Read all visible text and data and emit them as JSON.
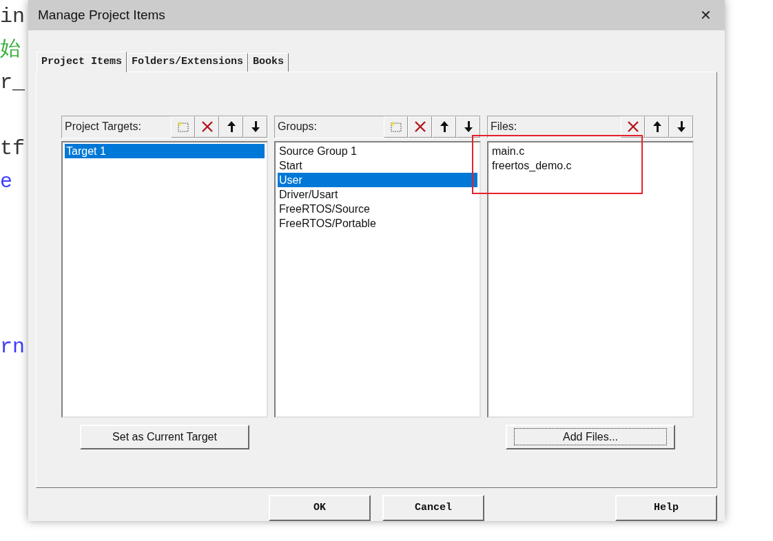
{
  "editor": {
    "lines": [
      {
        "kind": "code",
        "text": "in",
        "color": "#333333"
      },
      {
        "kind": "code",
        "text": "始",
        "color": "#3cb043"
      },
      {
        "kind": "code",
        "text": "r_",
        "color": "#333333"
      },
      {
        "kind": "blank"
      },
      {
        "kind": "code",
        "text": "tf",
        "color": "#333333"
      },
      {
        "kind": "code",
        "text": "e",
        "color": "#3b3bff"
      },
      {
        "kind": "blank"
      },
      {
        "kind": "blank"
      },
      {
        "kind": "blank"
      },
      {
        "kind": "blank"
      },
      {
        "kind": "code",
        "text": "rn",
        "color": "#3b3bff"
      }
    ]
  },
  "window": {
    "title": "Manage Project Items",
    "close": "✕"
  },
  "tabs": [
    {
      "label": "Project Items",
      "selected": true
    },
    {
      "label": "Folders/Extensions",
      "selected": false
    },
    {
      "label": "Books",
      "selected": false
    }
  ],
  "panels": [
    {
      "label": "Project Targets:",
      "tools": [
        {
          "kind": "new"
        },
        {
          "kind": "delete"
        },
        {
          "kind": "up"
        },
        {
          "kind": "down"
        }
      ],
      "items": [
        {
          "label": "Target 1",
          "selected": true
        }
      ],
      "button": {
        "label": "Set as Current Target",
        "focused": false
      }
    },
    {
      "label": "Groups:",
      "tools": [
        {
          "kind": "new"
        },
        {
          "kind": "delete"
        },
        {
          "kind": "up"
        },
        {
          "kind": "down"
        }
      ],
      "items": [
        {
          "label": "Source Group 1",
          "selected": false
        },
        {
          "label": "Start",
          "selected": false
        },
        {
          "label": "User",
          "selected": true
        },
        {
          "label": "Driver/Usart",
          "selected": false
        },
        {
          "label": "FreeRTOS/Source",
          "selected": false
        },
        {
          "label": "FreeRTOS/Portable",
          "selected": false
        }
      ]
    },
    {
      "label": "Files:",
      "tools": [
        {
          "kind": "delete"
        },
        {
          "kind": "up"
        },
        {
          "kind": "down"
        }
      ],
      "annotation": {
        "kind": "frame"
      },
      "items": [
        {
          "label": "main.c",
          "selected": false
        },
        {
          "label": "freertos_demo.c",
          "selected": false
        }
      ],
      "button": {
        "label": "Add Files...",
        "focused": true
      }
    }
  ],
  "buttons": [
    "OK",
    "Cancel",
    "Help"
  ]
}
